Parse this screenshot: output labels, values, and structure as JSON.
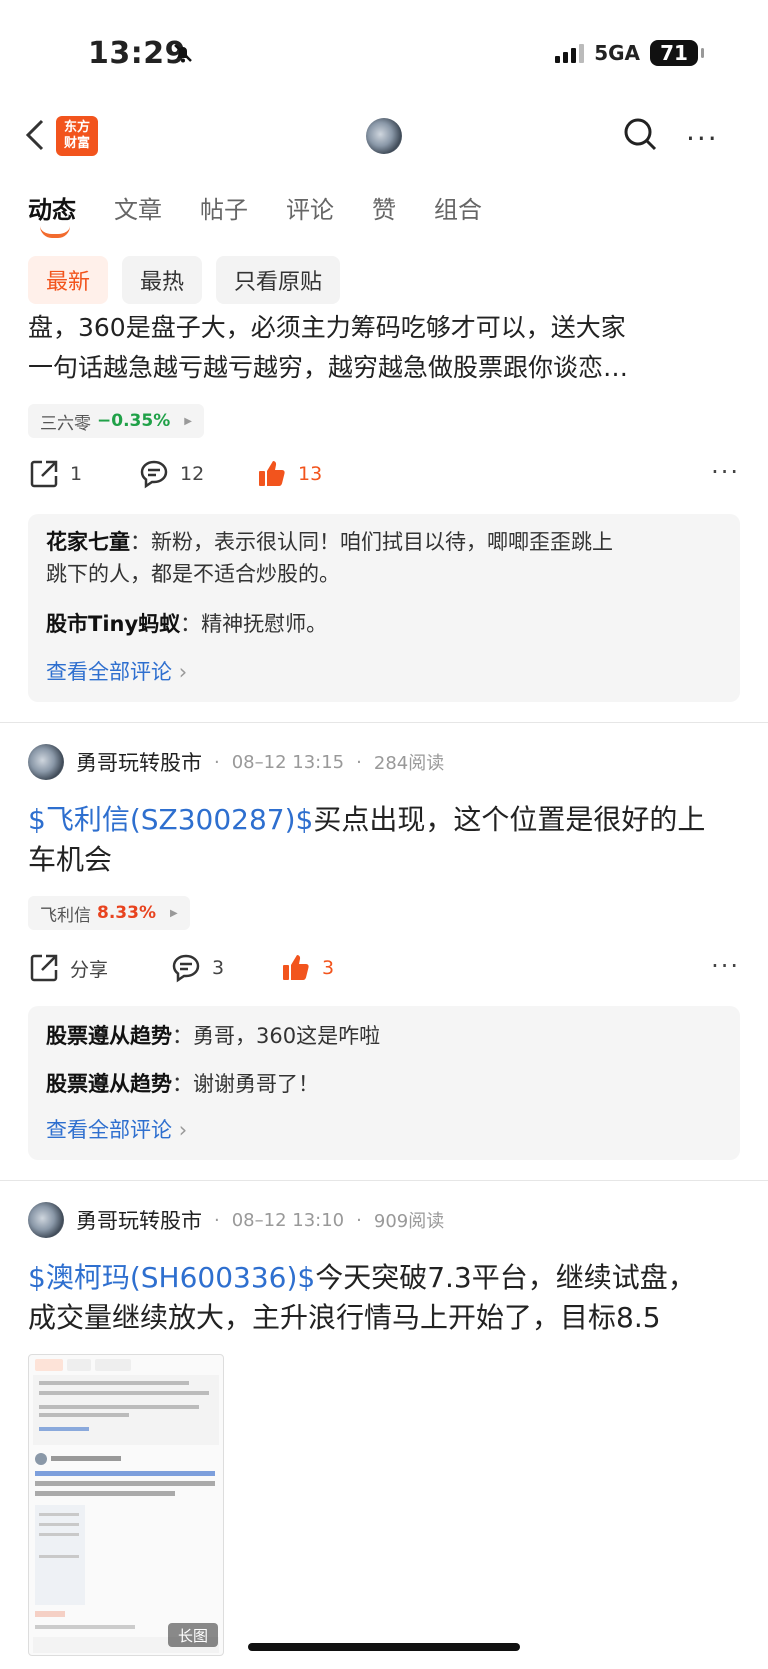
{
  "status": {
    "time": "13:29",
    "network": "5GA",
    "battery": "71"
  },
  "header": {
    "logo_line1": "东方",
    "logo_line2": "财富"
  },
  "tabs": [
    "动态",
    "文章",
    "帖子",
    "评论",
    "赞",
    "组合"
  ],
  "filters": [
    "最新",
    "最热",
    "只看原贴"
  ],
  "posts": [
    {
      "text_line1": "盘，360是盘子大，必须主力筹码吃够才可以，送大家",
      "text_line2": "一句话越急越亏越亏越穷，越穷越急做股票跟你谈恋…",
      "stock_name": "三六零",
      "stock_change": "−0.35%",
      "share": "1",
      "comments": "12",
      "likes": "13",
      "comment_lines": [
        {
          "user": "花家七童",
          "sep": "：",
          "text1": "新粉，表示很认同！咱们拭目以待，唧唧歪歪跳上",
          "text2": "跳下的人，都是不适合炒股的。"
        },
        {
          "user": "股市Tiny蚂蚁",
          "sep": "：",
          "text1": "精神抚慰师。"
        }
      ],
      "view_all": "查看全部评论"
    },
    {
      "author": "勇哥玩转股市",
      "date": "08–12 13:15",
      "reads": "284阅读",
      "stock_link": "$飞利信(SZ300287)$",
      "text_a": "买点出现，这个位置是很好的上",
      "text_b": "车机会",
      "stock_name": "飞利信",
      "stock_change": "8.33%",
      "share": "分享",
      "comments": "3",
      "likes": "3",
      "comment_lines": [
        {
          "user": "股票遵从趋势",
          "sep": "：",
          "text1": "勇哥，360这是咋啦"
        },
        {
          "user": "股票遵从趋势",
          "sep": "：",
          "text1": "谢谢勇哥了！"
        }
      ],
      "view_all": "查看全部评论"
    },
    {
      "author": "勇哥玩转股市",
      "date": "08–12 13:10",
      "reads": "909阅读",
      "stock_link": "$澳柯玛(SH600336)$",
      "text_a": "今天突破7.3平台，继续试盘，",
      "text_b": "成交量继续放大，主升浪行情马上开始了，目标8.5",
      "image_label": "长图"
    }
  ],
  "icons": {
    "back": "chevron-left-icon",
    "search": "search-icon",
    "more": "more-dots-icon",
    "share": "share-icon",
    "comment": "comment-icon",
    "like": "thumbs-up-icon",
    "mute": "bell-slash-icon"
  },
  "colors": {
    "accent": "#f2541d",
    "link": "#2e6fcf",
    "down": "#20a148",
    "up": "#e8431f"
  }
}
